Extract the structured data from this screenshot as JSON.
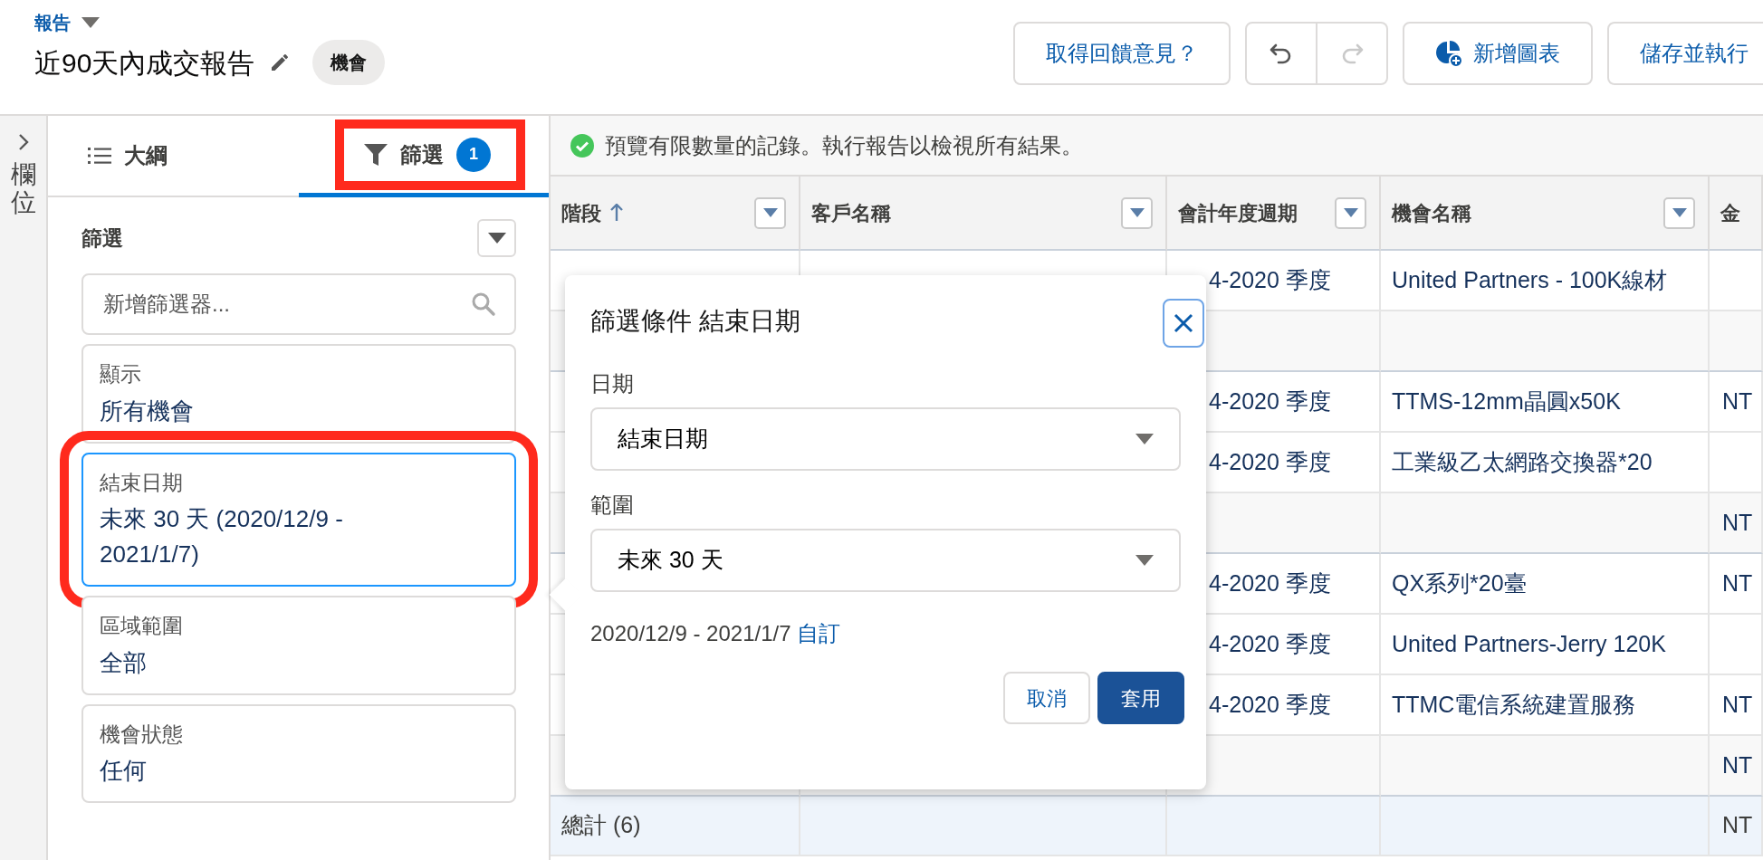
{
  "breadcrumb": {
    "label": "報告"
  },
  "title": "近90天內成交報告",
  "object_pill": "機會",
  "feedback_button": "取得回饋意見？",
  "undo": {
    "disabled": false
  },
  "redo": {
    "disabled": true
  },
  "add_chart_button": "新增圖表",
  "save_run_button": "儲存並執行",
  "side_strip": {
    "label": "欄位"
  },
  "tabs": [
    {
      "kind": "outline",
      "label": "大綱",
      "selected": false,
      "highlighted": false
    },
    {
      "kind": "filter",
      "label": "篩選",
      "count": "1",
      "selected": true,
      "highlighted": true
    }
  ],
  "filters": {
    "heading": "篩選",
    "search": {
      "placeholder": "新增篩選器..."
    },
    "items": [
      {
        "label": "顯示",
        "value": "所有機會",
        "selected": false,
        "highlighted": false
      },
      {
        "label": "結束日期",
        "value": "未來 30 天 (2020/12/9 - 2021/1/7)",
        "selected": true,
        "highlighted": true
      },
      {
        "label": "區域範圍",
        "value": "全部",
        "selected": false,
        "highlighted": false
      },
      {
        "label": "機會狀態",
        "value": "任何",
        "selected": false,
        "highlighted": false
      }
    ]
  },
  "notice": "預覽有限數量的記錄。執行報告以檢視所有結果。",
  "table": {
    "columns": [
      {
        "label": "階段",
        "sorted": true,
        "menu": true
      },
      {
        "label": "客戶名稱",
        "menu": true
      },
      {
        "label": "會計年度週期",
        "menu": true
      },
      {
        "label": "機會名稱",
        "menu": true
      },
      {
        "label": "金",
        "menu": false
      }
    ],
    "rows": [
      {
        "kind": "detail",
        "fiscal_period": "4-2020 季度",
        "opportunity": "United Partners - 100K線材"
      },
      {
        "kind": "subtotal"
      },
      {
        "kind": "detail",
        "fiscal_period": "4-2020 季度",
        "opportunity": "TTMS-12mm晶圓x50K",
        "amount": "NT"
      },
      {
        "kind": "detail",
        "fiscal_period": "4-2020 季度",
        "opportunity": "工業級乙太網路交換器*20"
      },
      {
        "kind": "subtotal",
        "amount": "NT"
      },
      {
        "kind": "detail",
        "fiscal_period": "4-2020 季度",
        "opportunity": "QX系列*20臺",
        "amount": "NT"
      },
      {
        "kind": "detail",
        "fiscal_period": "4-2020 季度",
        "opportunity": "United Partners-Jerry 120K"
      },
      {
        "kind": "detail",
        "fiscal_period": "4-2020 季度",
        "opportunity": "TTMC電信系統建置服務",
        "amount": "NT"
      },
      {
        "kind": "subtotal",
        "amount": "NT"
      },
      {
        "kind": "total",
        "stage": "總計 (6)",
        "amount": "NT"
      }
    ]
  },
  "popover": {
    "title": "篩選條件 結束日期",
    "fields": [
      {
        "label": "日期",
        "value": "結束日期"
      },
      {
        "label": "範圍",
        "value": "未來 30 天"
      }
    ],
    "range_text": "2020/12/9 - 2021/1/7",
    "custom_link": "自訂",
    "buttons": [
      {
        "kind": "neutral",
        "label": "取消"
      },
      {
        "kind": "brand",
        "label": "套用"
      }
    ]
  }
}
